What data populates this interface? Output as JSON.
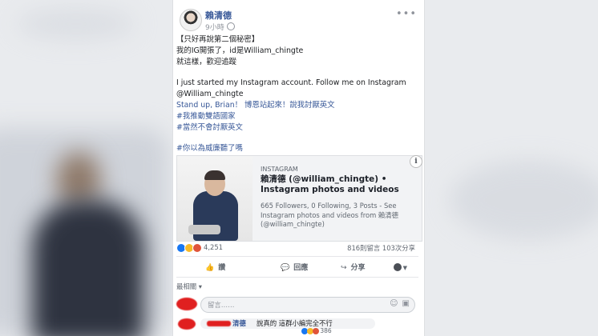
{
  "post": {
    "author": "賴清德",
    "time": "9小時",
    "line1": "【只好再說第二個秘密】",
    "line2": "我的IG開張了，id是William_chingte",
    "line3": "就這樣，歡迎追蹤",
    "line4": "I just started my Instagram account. Follow me on Instagram",
    "line5": "@William_chingte",
    "line6": "Stand up, Brian！ 博恩站起來！說我討厭英文",
    "line7": "#我推動雙語國家",
    "line8": "#當然不會討厭英文",
    "line9": "#你以為威廉聽了嗎"
  },
  "preview": {
    "source": "INSTAGRAM",
    "title": "賴清德 (@william_chingte) • Instagram photos and videos",
    "description": "665 Followers, 0 Following, 3 Posts - See Instagram photos and videos from 賴清德 (@william_chingte)",
    "info_label": "i"
  },
  "stats": {
    "reactions": "4,251",
    "comments_shares": "816則留言 103次分享"
  },
  "actions": {
    "like": "讚",
    "comment": "回應",
    "share": "分享",
    "like_icon": "thumb-icon",
    "comment_icon": "speech-icon",
    "share_icon": "arrow-icon"
  },
  "sort_label": "最相關 ▾",
  "comment_input": {
    "placeholder": "留言……"
  },
  "comment": {
    "name": "清德",
    "text": "說真的 這群小編完全不行",
    "reactions": "386"
  },
  "colors": {
    "link": "#385898",
    "like": "#1877f2",
    "haha": "#f7b928",
    "angry": "#e0543a"
  }
}
